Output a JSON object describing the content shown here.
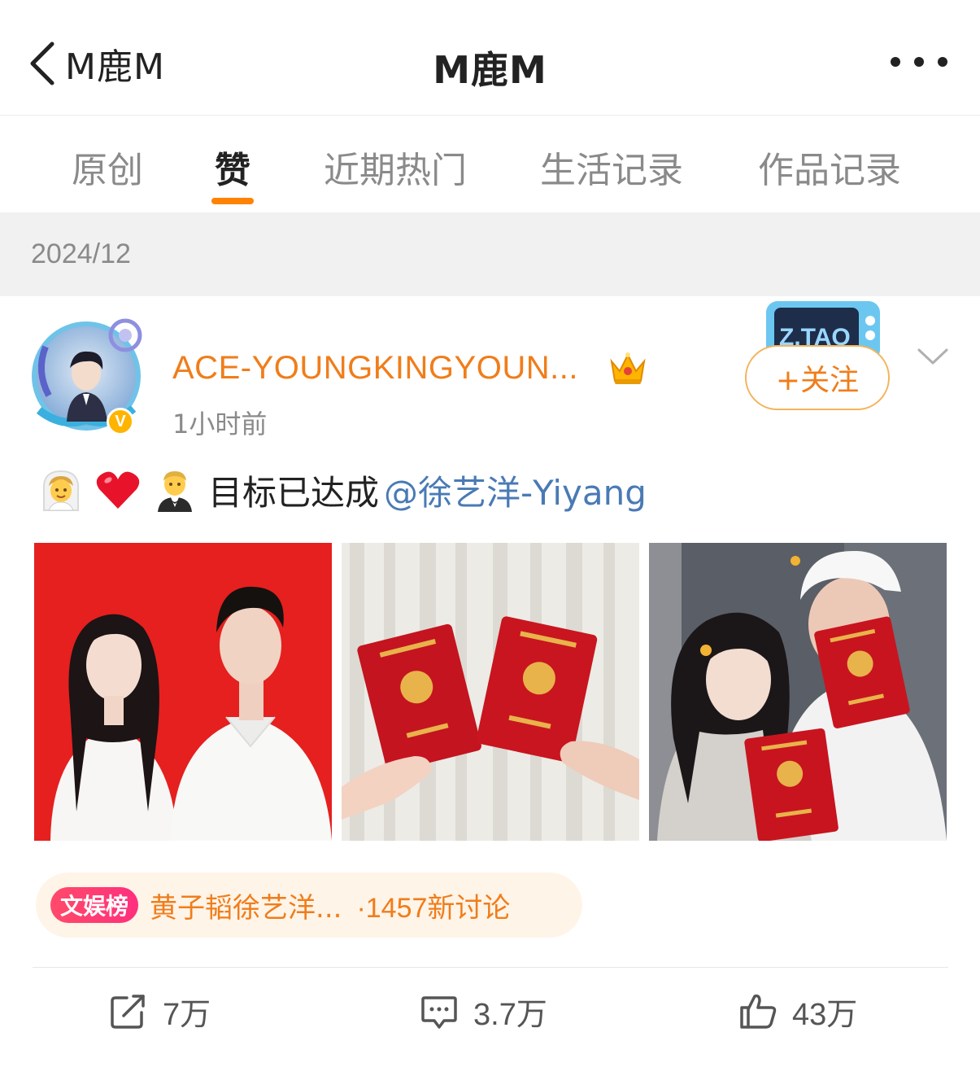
{
  "nav": {
    "back_label": "M鹿M",
    "title": "M鹿M",
    "back_icon": "chevron-left-icon",
    "more_icon": "more-dots-icon"
  },
  "tabs": [
    {
      "label": "原创",
      "active": false
    },
    {
      "label": "赞",
      "active": true
    },
    {
      "label": "近期热门",
      "active": false
    },
    {
      "label": "生活记录",
      "active": false
    },
    {
      "label": "作品记录",
      "active": false
    }
  ],
  "date_header": "2024/12",
  "post": {
    "author": "ACE-YOUNGKINGYOUN...",
    "time": "1小时前",
    "follow_label": "+关注",
    "verified_badge": "V",
    "text": "目标已达成",
    "emojis": [
      "bride-icon",
      "red-heart-icon",
      "groom-icon"
    ],
    "mention": "@徐艺洋-Yiyang",
    "tv_decoration_text": "Z.TAO",
    "topic": {
      "tag": "文娱榜",
      "title": "黄子韬徐艺洋...",
      "count": "·1457新讨论"
    },
    "actions": {
      "repost": "7万",
      "comment": "3.7万",
      "like": "43万"
    }
  },
  "colors": {
    "accent": "#ff8200",
    "username": "#f07d1a",
    "mention": "#4a7ab5",
    "muted": "#8a8a8a"
  }
}
